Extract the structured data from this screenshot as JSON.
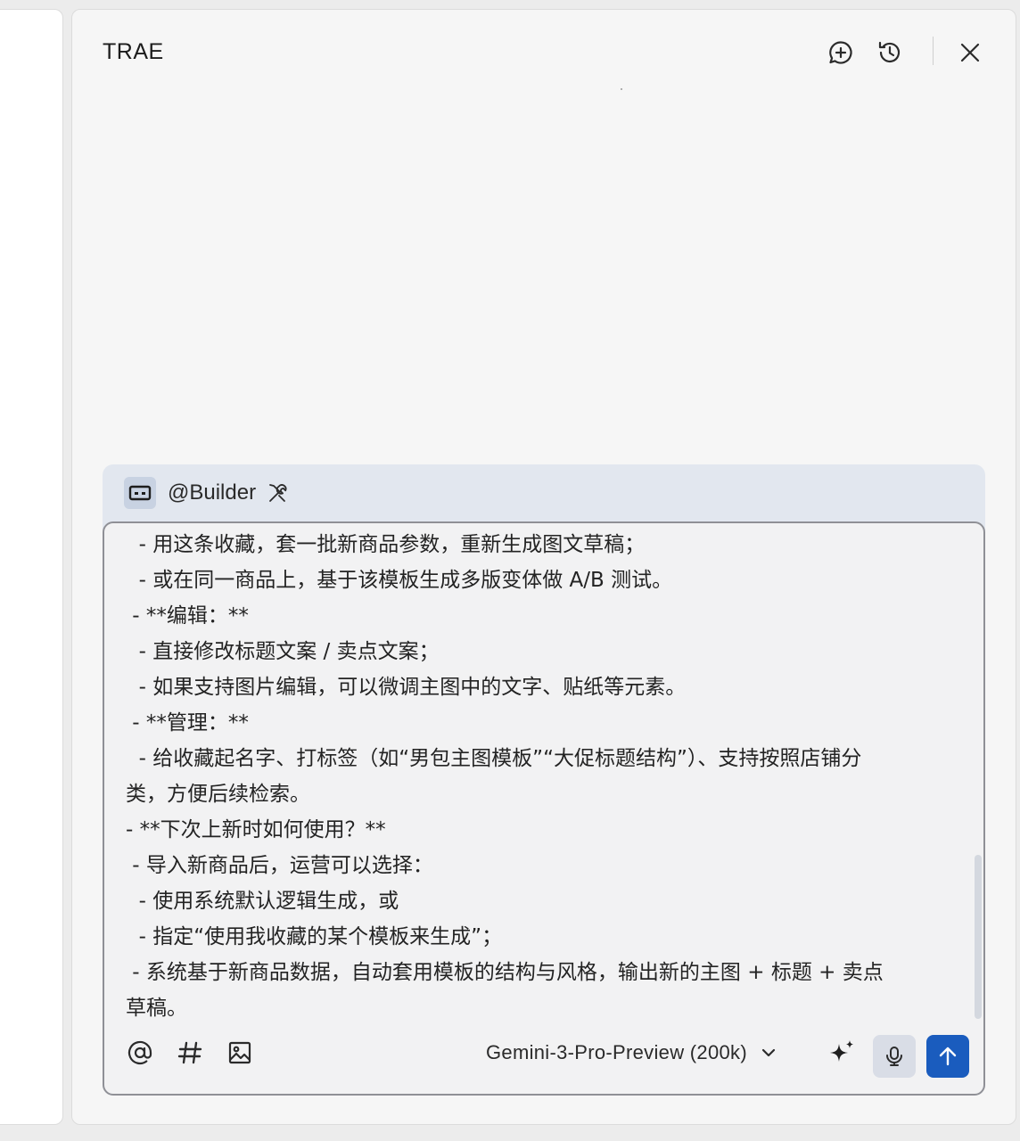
{
  "header": {
    "title": "TRAE",
    "icons": [
      "new-chat-icon",
      "history-icon",
      "close-icon"
    ]
  },
  "composer": {
    "agent_label": "@Builder",
    "agent_icon": "agent-badge-icon",
    "tool_icon": "tools-icon",
    "lines": [
      "  - 用这条收藏，套一批新商品参数，重新生成图文草稿；",
      "  - 或在同一商品上，基于该模板生成多版变体做 A/B 测试。",
      " - **编辑：**",
      "  - 直接修改标题文案 / 卖点文案；",
      "  - 如果支持图片编辑，可以微调主图中的文字、贴纸等元素。",
      " - **管理：**",
      "  - 给收藏起名字、打标签（如“男包主图模板”“大促标题结构”）、支持按照店铺分",
      "类，方便后续检索。",
      "- **下次上新时如何使用？**",
      " - 导入新商品后，运营可以选择：",
      "  - 使用系统默认逻辑生成，或",
      "  - 指定“使用我收藏的某个模板来生成”；",
      " - 系统基于新商品数据，自动套用模板的结构与风格，输出新的主图 + 标题 + 卖点",
      "草稿。"
    ],
    "toolbar": {
      "mention_icon": "at-icon",
      "context_icon": "hash-icon",
      "image_icon": "image-icon",
      "model": "Gemini-3-Pro-Preview (200k)",
      "model_chevron": "chevron-down-icon",
      "enhance_icon": "sparkle-icon",
      "voice_icon": "microphone-icon",
      "send_icon": "arrow-up-icon"
    }
  },
  "colors": {
    "panel_bg": "#f6f6f6",
    "composer_bg": "#e2e7ef",
    "editor_bg": "#f2f2f3",
    "send_button": "#1a5cbe",
    "mic_button": "#d9dde6"
  }
}
